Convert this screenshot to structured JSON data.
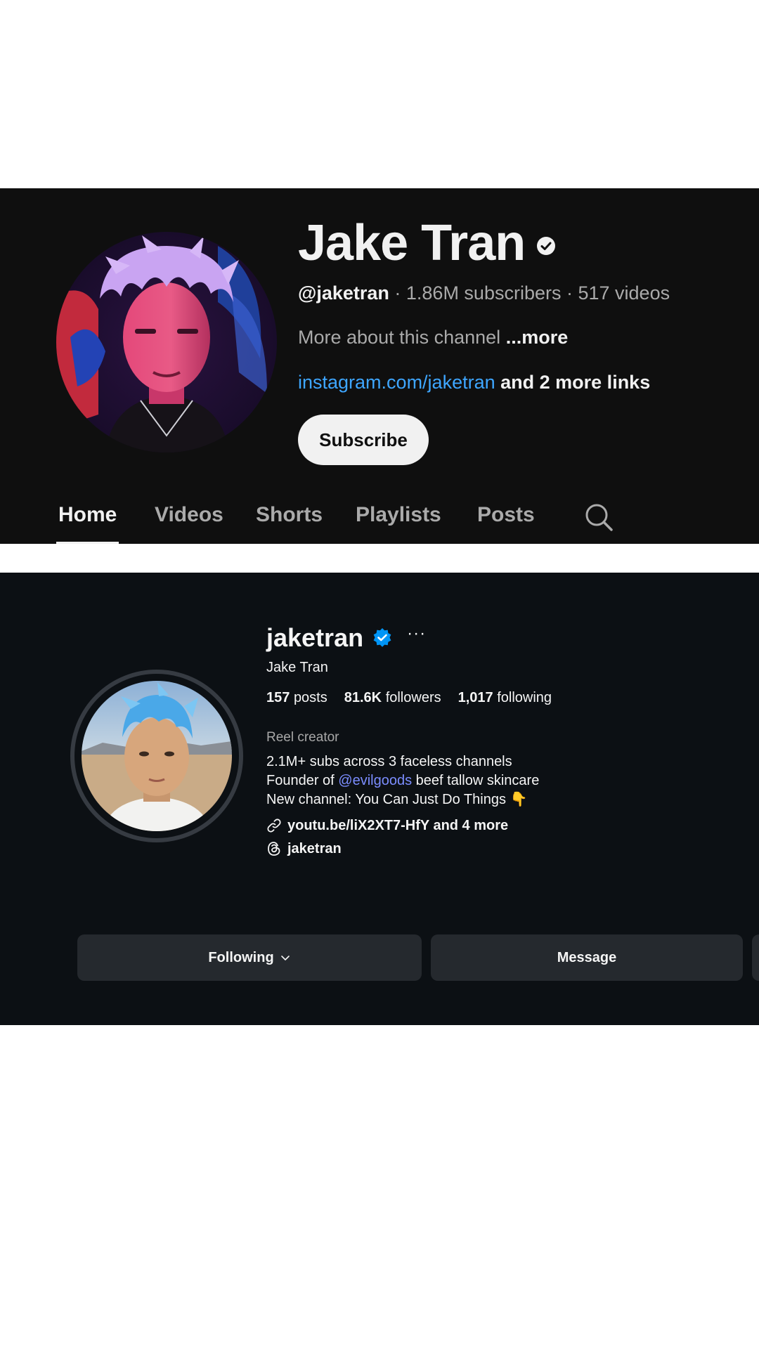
{
  "youtube": {
    "channel_name": "Jake Tran",
    "handle": "@jaketran",
    "subscribers": "1.86M subscribers",
    "videos": "517 videos",
    "separator": " · ",
    "about_text": "More about this channel",
    "about_more": "...more",
    "link_text": "instagram.com/jaketran",
    "link_more": "and 2 more links",
    "subscribe_label": "Subscribe",
    "tabs": [
      {
        "label": "Home",
        "active": true
      },
      {
        "label": "Videos"
      },
      {
        "label": "Shorts"
      },
      {
        "label": "Playlists"
      },
      {
        "label": "Posts"
      }
    ],
    "colors": {
      "background": "#0f0f0f",
      "text": "#f1f1f1",
      "muted": "#aaaaaa",
      "link": "#3ea6ff"
    }
  },
  "instagram": {
    "username": "jaketran",
    "options_icon": "more-options-icon",
    "full_name": "Jake Tran",
    "stats": {
      "posts_count": "157",
      "posts_label": "posts",
      "followers_count": "81.6K",
      "followers_label": "followers",
      "following_count": "1,017",
      "following_label": "following"
    },
    "category": "Reel creator",
    "bio": {
      "line1": "2.1M+ subs across 3 faceless channels",
      "line2_prefix": "Founder of",
      "line2_mention": "@evilgoods",
      "line2_suffix": "beef tallow skincare",
      "line3": "New channel: You Can Just Do Things 👇"
    },
    "link_text": "youtu.be/liX2XT7-HfY and 4 more",
    "threads_handle": "jaketran",
    "following_label": "Following",
    "message_label": "Message",
    "colors": {
      "background": "#0c1014",
      "button": "#25292e",
      "mention": "#7b8dff",
      "verified": "#0095f6"
    }
  }
}
